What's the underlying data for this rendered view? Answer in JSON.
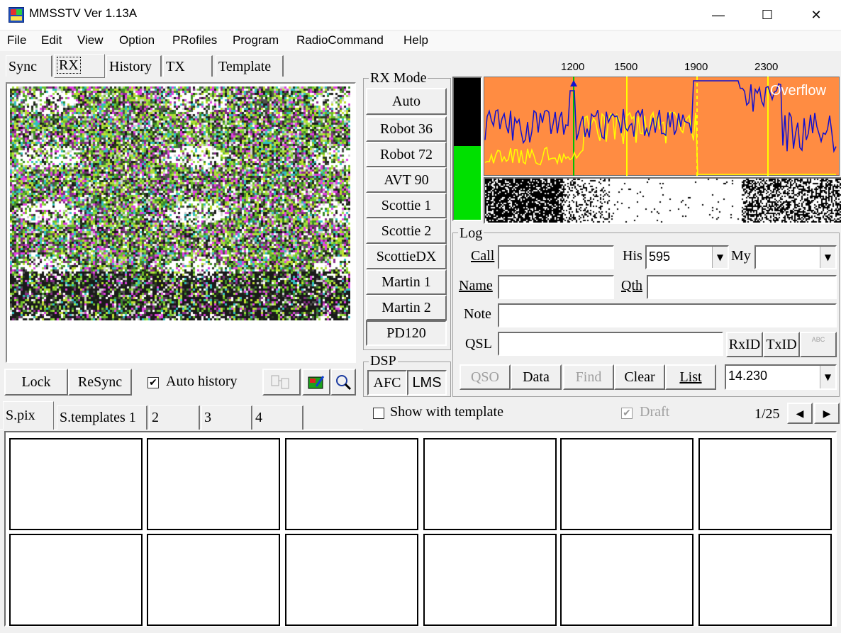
{
  "window": {
    "title": "MMSSTV Ver 1.13A",
    "min": "—",
    "max": "☐",
    "close": "✕"
  },
  "menu": [
    "File",
    "Edit",
    "View",
    "Option",
    "PRofiles",
    "Program",
    "RadioCommand",
    "Help"
  ],
  "top_tabs": [
    "Sync",
    "RX",
    "History",
    "TX",
    "Template"
  ],
  "rx_controls": {
    "lock": "Lock",
    "resync": "ReSync",
    "auto_history": "Auto history",
    "auto_history_checked": true
  },
  "rx_mode": {
    "label": "RX Mode",
    "buttons": [
      "Auto",
      "Robot 36",
      "Robot 72",
      "AVT 90",
      "Scottie 1",
      "Scottie 2",
      "ScottieDX",
      "Martin 1",
      "Martin 2",
      "PD120"
    ],
    "selected": "PD120"
  },
  "dsp": {
    "label": "DSP",
    "afc": "AFC",
    "lms": "LMS"
  },
  "spectrum": {
    "ticks": [
      "1200",
      "1500",
      "1900",
      "2300"
    ],
    "overflow": "Overflow"
  },
  "log": {
    "label": "Log",
    "call_label": "Call",
    "call_value": "",
    "his_label": "His",
    "his_value": "595",
    "my_label": "My",
    "my_value": "",
    "name_label": "Name",
    "name_value": "",
    "qth_label": "Qth",
    "qth_value": "",
    "note_label": "Note",
    "note_value": "",
    "qsl_label": "QSL",
    "qsl_value": "",
    "rxid": "RxID",
    "txid": "TxID",
    "abc": "ABC",
    "qso": "QSO",
    "data": "Data",
    "find": "Find",
    "clear": "Clear",
    "list": "List",
    "freq": "14.230"
  },
  "bottom_tabs": [
    "S.pix",
    "S.templates 1",
    "2",
    "3",
    "4"
  ],
  "template_bar": {
    "show_with_template": "Show with template",
    "show_checked": false,
    "draft": "Draft",
    "draft_checked": true,
    "page": "1/25",
    "prev": "◀",
    "next": "▶"
  },
  "colors": {
    "spectrum_bg": "#ff8c42",
    "level_green": "#00e000",
    "blue_trace": "#1010d0",
    "yellow_trace": "#ffff00"
  }
}
